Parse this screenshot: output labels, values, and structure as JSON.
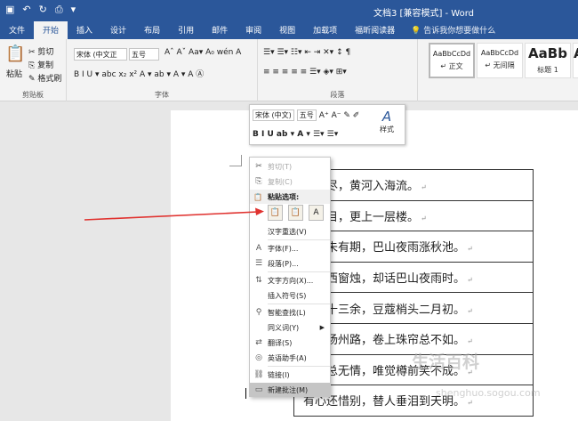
{
  "titlebar": {
    "title": "文档3 [兼容模式] - Word",
    "qat": [
      {
        "icon": "save-icon",
        "glyph": "▣"
      },
      {
        "icon": "undo-icon",
        "glyph": "↶"
      },
      {
        "icon": "redo-icon",
        "glyph": "↻"
      },
      {
        "icon": "print-preview-icon",
        "glyph": "⎙"
      },
      {
        "icon": "customize-icon",
        "glyph": "▾"
      }
    ]
  },
  "tabs": [
    {
      "label": "文件",
      "active": false
    },
    {
      "label": "开始",
      "active": true
    },
    {
      "label": "插入",
      "active": false
    },
    {
      "label": "设计",
      "active": false
    },
    {
      "label": "布局",
      "active": false
    },
    {
      "label": "引用",
      "active": false
    },
    {
      "label": "邮件",
      "active": false
    },
    {
      "label": "审阅",
      "active": false
    },
    {
      "label": "视图",
      "active": false
    },
    {
      "label": "加载项",
      "active": false
    },
    {
      "label": "福昕阅读器",
      "active": false
    }
  ],
  "tellme": "告诉我你想要做什么",
  "ribbon": {
    "clipboard": {
      "label": "剪贴板",
      "paste": "粘贴",
      "cut": "剪切",
      "copy": "复制",
      "format_painter": "格式刷"
    },
    "font": {
      "label": "字体",
      "font_name": "宋体 (中文正",
      "font_size": "五号",
      "row1": "Aˆ Aˇ Aa▾ A₀ wén A",
      "row2": "B I U ▾ abc x₂ x²  A ▾ ab ▾ A ▾ A Ⓐ"
    },
    "paragraph": {
      "label": "段落",
      "row1": "☰▾ ☰▾ ☷▾ ⇤ ⇥ ✕▾ ↕ ¶",
      "row2": "≡ ≡ ≡ ≡ ≡ ☰▾ ◈▾ ⊞▾"
    },
    "styles": [
      {
        "preview": "AaBbCcDd",
        "name": "↵ 正文",
        "big": false,
        "selected": true
      },
      {
        "preview": "AaBbCcDd",
        "name": "↵ 无间隔",
        "big": false,
        "selected": false
      },
      {
        "preview": "AaBb",
        "name": "标题 1",
        "big": true,
        "selected": false
      },
      {
        "preview": "Aa",
        "name": "",
        "big": true,
        "selected": false
      }
    ]
  },
  "mini_toolbar": {
    "font_name": "宋体 (中文)",
    "font_size": "五号",
    "row1_tools": "A⁺ A⁻ ✎ ✐",
    "row2_tools": "B I U ab ▾ A ▾ ☰▾ ☰▾",
    "styles_label": "样式"
  },
  "context_menu": {
    "cut": "剪切(T)",
    "copy": "复制(C)",
    "paste_options": "粘贴选项:",
    "paste_icons": [
      "📋",
      "📋",
      "A"
    ],
    "hanzi": "汉字重选(V)",
    "font": "字体(F)...",
    "paragraph": "段落(P)...",
    "text_direction": "文字方向(X)...",
    "insert_symbol": "插入符号(S)",
    "smart_lookup": "智能查找(L)",
    "synonyms": "同义词(Y)",
    "translate": "翻译(S)",
    "english_assistant": "英语助手(A)",
    "link": "链接(I)",
    "new_comment": "新建批注(M)"
  },
  "document": {
    "rows": [
      "依山尽，黄河入海流。",
      "千里目，更上一层楼。",
      "归期未有期，巴山夜雨涨秋池。",
      "共剪西窗烛，却话巴山夜雨时。",
      "袅袅十三余，豆蔻梢头二月初。",
      "十里扬州路，卷上珠帘总不如。",
      "却似总无情，唯觉樽前笑不成。",
      "有心还惜别，替人垂泪到天明。"
    ],
    "return_mark": "↵"
  },
  "watermark": {
    "main": "生活百科",
    "sub": "shenghuo.sogou.com"
  },
  "colors": {
    "brand": "#2b579a",
    "arrow": "#e0322f",
    "menu_highlight": "#c5c5c5"
  }
}
